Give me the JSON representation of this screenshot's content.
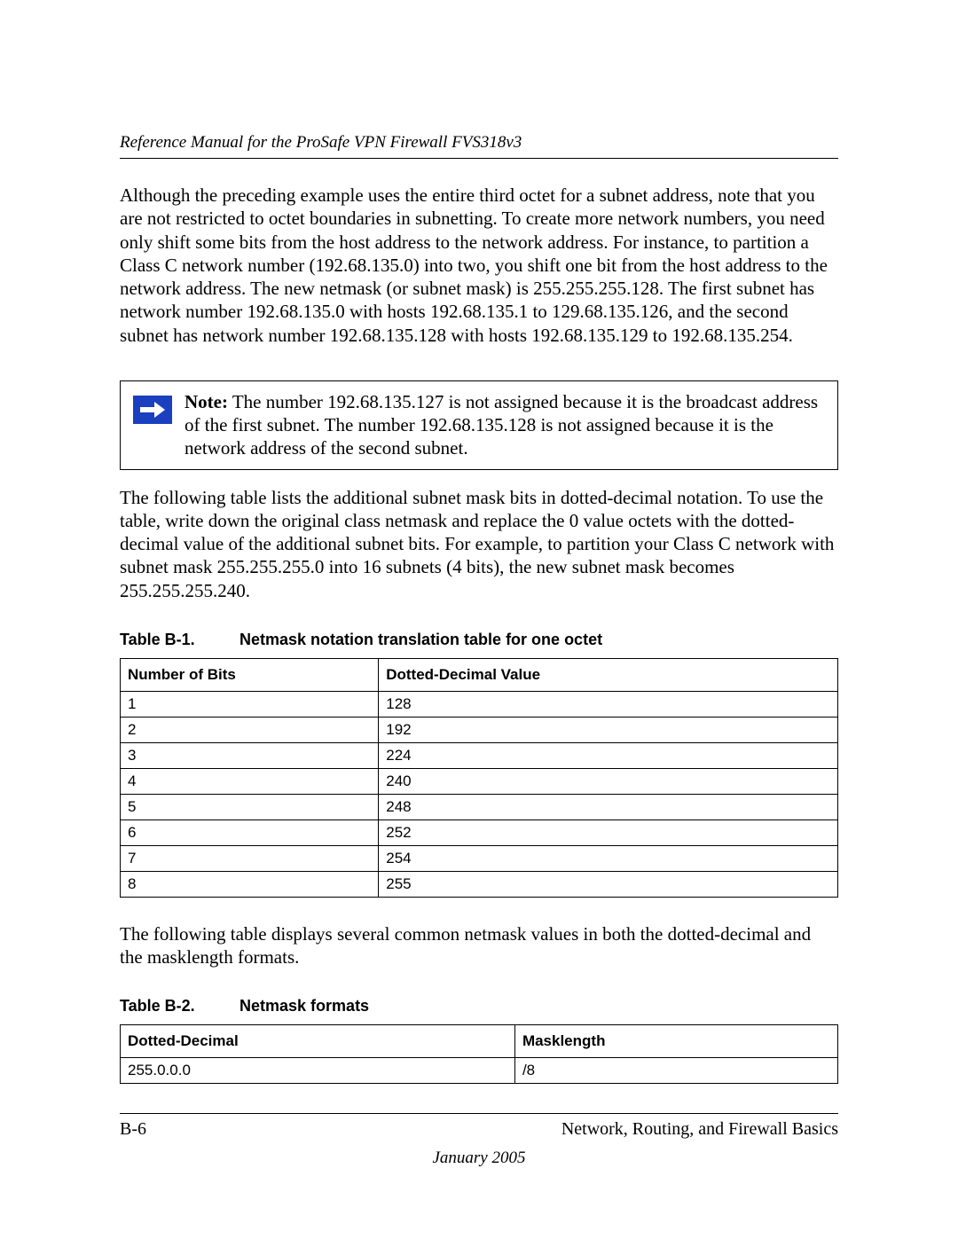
{
  "header": {
    "title": "Reference Manual for the ProSafe VPN Firewall FVS318v3"
  },
  "paragraphs": {
    "p1": "Although the preceding example uses the entire third octet for a subnet address, note that you are not restricted to octet boundaries in subnetting. To create more network numbers, you need only shift some bits from the host address to the network address. For instance, to partition a Class C network number (192.68.135.0) into two, you shift one bit from the host address to the network address. The new netmask (or subnet mask) is 255.255.255.128. The first subnet has network number 192.68.135.0 with hosts 192.68.135.1 to 129.68.135.126, and the second subnet has network number 192.68.135.128 with hosts 192.68.135.129 to 192.68.135.254.",
    "note_label": "Note:",
    "note_body": " The number 192.68.135.127 is not assigned because it is the broadcast address of the first subnet. The number 192.68.135.128 is not assigned because it is the network address of the second subnet.",
    "p2": "The following table lists the additional subnet mask bits in dotted-decimal notation. To use the table, write down the original class netmask and replace the 0 value octets with the dotted-decimal value of the additional subnet bits. For example, to partition your Class C network with subnet mask 255.255.255.0 into 16 subnets (4 bits), the new subnet mask becomes 255.255.255.240.",
    "p3": "The following table displays several common netmask values in both the dotted-decimal and the masklength formats."
  },
  "table1": {
    "label": "Table B-1.",
    "title": "Netmask notation translation table for one octet",
    "headers": [
      "Number of Bits",
      "Dotted-Decimal Value"
    ],
    "rows": [
      [
        "1",
        "128"
      ],
      [
        "2",
        "192"
      ],
      [
        "3",
        "224"
      ],
      [
        "4",
        "240"
      ],
      [
        "5",
        "248"
      ],
      [
        "6",
        "252"
      ],
      [
        "7",
        "254"
      ],
      [
        "8",
        "255"
      ]
    ]
  },
  "table2": {
    "label": "Table B-2.",
    "title": "Netmask formats",
    "headers": [
      "Dotted-Decimal",
      "Masklength"
    ],
    "rows": [
      [
        "255.0.0.0",
        "/8"
      ]
    ]
  },
  "footer": {
    "page_num": "B-6",
    "section": "Network, Routing, and Firewall Basics",
    "date": "January 2005"
  }
}
